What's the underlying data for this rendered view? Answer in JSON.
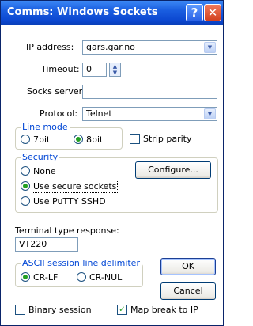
{
  "window": {
    "title": "Comms: Windows Sockets"
  },
  "titlebar": {
    "help_glyph": "?",
    "close_glyph": "✕"
  },
  "ip": {
    "label": "IP address:",
    "value": "gars.gar.no"
  },
  "timeout": {
    "label": "Timeout:",
    "value": "0"
  },
  "socks": {
    "label": "Socks server:",
    "value": ""
  },
  "protocol": {
    "label": "Protocol:",
    "value": "Telnet"
  },
  "line_mode": {
    "title": "Line mode",
    "options": [
      "7bit",
      "8bit"
    ],
    "selected": "8bit"
  },
  "strip_parity": {
    "label": "Strip parity",
    "checked": false
  },
  "security": {
    "title": "Security",
    "options": [
      "None",
      "Use secure sockets",
      "Use PuTTY SSHD"
    ],
    "selected": "Use secure sockets"
  },
  "configure_button": "Configure...",
  "terminal": {
    "label": "Terminal type response:",
    "value": "VT220"
  },
  "ascii_delim": {
    "title": "ASCII session line delimiter",
    "options": [
      "CR-LF",
      "CR-NUL"
    ],
    "selected": "CR-LF"
  },
  "ok_button": "OK",
  "cancel_button": "Cancel",
  "binary_session": {
    "label": "Binary session",
    "checked": false
  },
  "map_break": {
    "label": "Map break to IP",
    "checked": true
  },
  "icons": {
    "dropdown": "chevron-down-icon",
    "spin_up": "arrow-up-icon",
    "spin_down": "arrow-down-icon",
    "check": "checkmark-icon"
  },
  "colors": {
    "title_bar": "#0b46cf",
    "group_title": "#0046d5",
    "radio_dot": "#22a022"
  }
}
